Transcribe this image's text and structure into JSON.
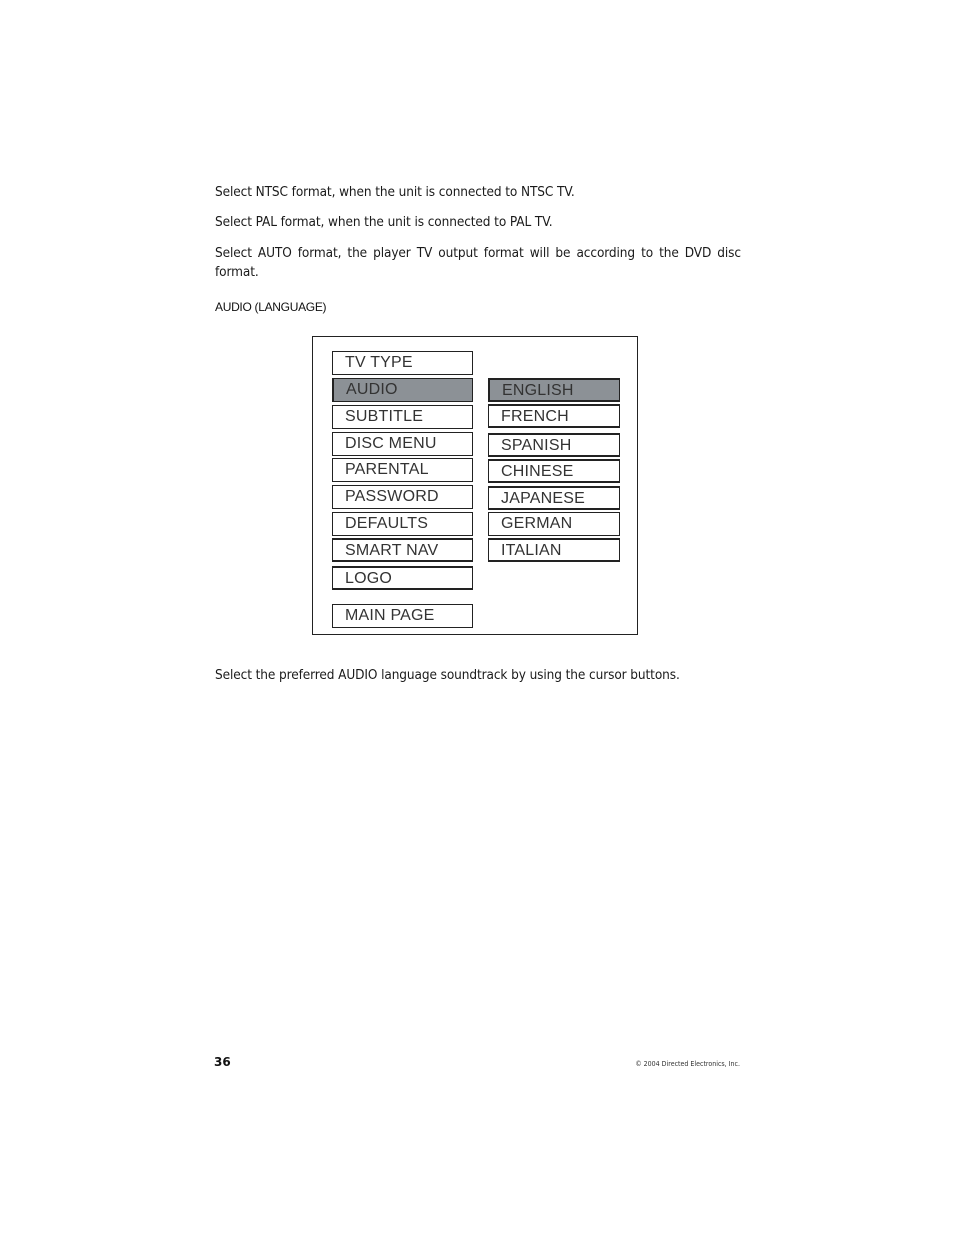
{
  "body": {
    "paragraphs": [
      "Select NTSC format, when the unit is connected to NTSC TV.",
      "Select PAL format, when the unit is connected to PAL TV.",
      "Select AUTO format, the player TV output format will be according to the DVD disc format."
    ],
    "section_heading": "AUDIO (LANGUAGE)",
    "closing_paragraph": "Select the preferred AUDIO language soundtrack by using the cursor buttons."
  },
  "osd_menu": {
    "selected_color": "#8c9196",
    "menu_items": [
      {
        "label": "TV TYPE",
        "selected": false
      },
      {
        "label": "AUDIO",
        "selected": true
      },
      {
        "label": "SUBTITLE",
        "selected": false
      },
      {
        "label": "DISC MENU",
        "selected": false
      },
      {
        "label": "PARENTAL",
        "selected": false
      },
      {
        "label": "PASSWORD",
        "selected": false
      },
      {
        "label": "DEFAULTS",
        "selected": false
      },
      {
        "label": "SMART NAV",
        "selected": false
      },
      {
        "label": "LOGO",
        "selected": false
      },
      {
        "label": "MAIN PAGE",
        "selected": false
      }
    ],
    "language_options": [
      {
        "label": "ENGLISH",
        "selected": true
      },
      {
        "label": "FRENCH",
        "selected": false
      },
      {
        "label": "SPANISH",
        "selected": false
      },
      {
        "label": "CHINESE",
        "selected": false
      },
      {
        "label": "JAPANESE",
        "selected": false
      },
      {
        "label": "GERMAN",
        "selected": false
      },
      {
        "label": "ITALIAN",
        "selected": false
      }
    ]
  },
  "footer": {
    "page_number": "36",
    "copyright": "© 2004 Directed Electronics, Inc."
  }
}
